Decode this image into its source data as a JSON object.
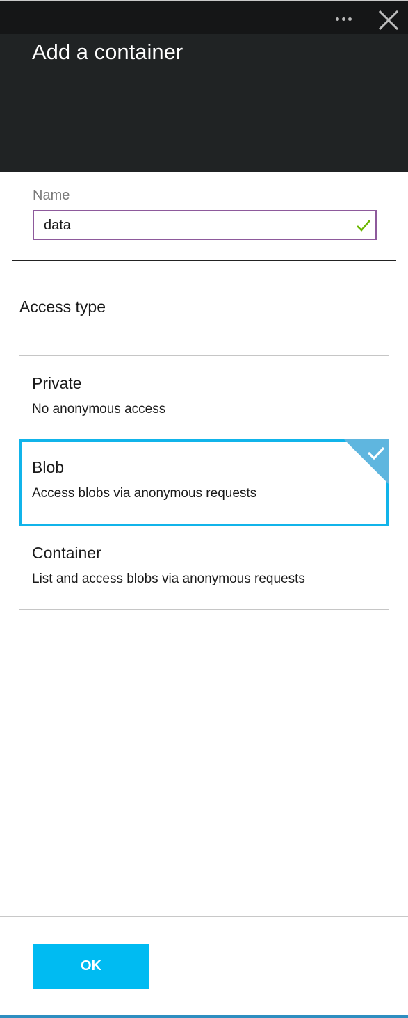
{
  "blade": {
    "title": "Add a container",
    "icons": {
      "more": "more-ellipsis-icon",
      "close": "close-x-icon"
    }
  },
  "name_field": {
    "label": "Name",
    "value": "data",
    "status_icon": "valid-checkmark-icon"
  },
  "access": {
    "title": "Access type",
    "options": [
      {
        "label": "Private",
        "description": "No anonymous access",
        "selected": false
      },
      {
        "label": "Blob",
        "description": "Access blobs via anonymous requests",
        "selected": true
      },
      {
        "label": "Container",
        "description": "List and access blobs via anonymous requests",
        "selected": false
      }
    ]
  },
  "footer": {
    "ok_label": "OK"
  },
  "colors": {
    "header_bg": "#202324",
    "header_bar": "#151617",
    "input_border": "#8e5a9c",
    "valid_green": "#6bb700",
    "selection": "#11b4ea",
    "ok_button": "#00bbf2",
    "bottom_accent": "#2e8ec0"
  }
}
